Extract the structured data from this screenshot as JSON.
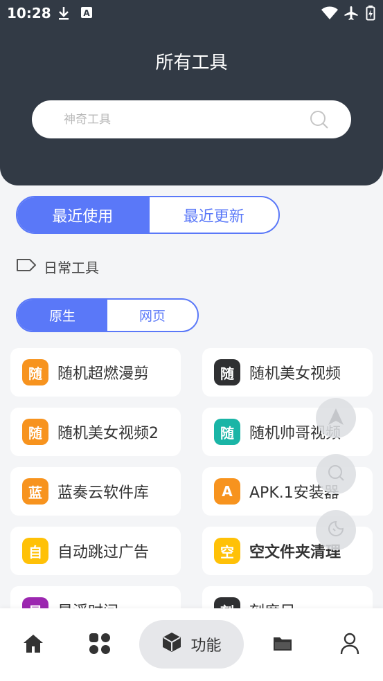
{
  "status_bar": {
    "time": "10:28",
    "icons": [
      "download-icon",
      "a-box-icon",
      "wifi-icon",
      "airplane-icon",
      "battery-icon"
    ]
  },
  "header": {
    "title": "所有工具",
    "search_placeholder": "神奇工具"
  },
  "tabs": {
    "items": [
      {
        "label": "最近使用",
        "active": true
      },
      {
        "label": "最近更新",
        "active": false
      }
    ]
  },
  "section": {
    "label": "日常工具",
    "icon": "tag-icon"
  },
  "subtabs": {
    "items": [
      {
        "label": "原生",
        "active": true
      },
      {
        "label": "网页",
        "active": false
      }
    ]
  },
  "tools": [
    {
      "badge": "随",
      "label": "随机超燃漫剪",
      "color": "#f7931e"
    },
    {
      "badge": "随",
      "label": "随机美女视频",
      "color": "#2f3032"
    },
    {
      "badge": "随",
      "label": "随机美女视频2",
      "color": "#f7931e"
    },
    {
      "badge": "随",
      "label": "随机帅哥视频",
      "color": "#1ab5a6"
    },
    {
      "badge": "蓝",
      "label": "蓝奏云软件库",
      "color": "#f7931e"
    },
    {
      "badge": "A",
      "label": "APK.1安装器",
      "color": "#f7931e"
    },
    {
      "badge": "自",
      "label": "自动跳过广告",
      "color": "#ffc107"
    },
    {
      "badge": "空",
      "label": "空文件夹清理",
      "color": "#ffc107"
    },
    {
      "badge": "星",
      "label": "星浮时间",
      "color": "#9c27b0"
    },
    {
      "badge": "刻",
      "label": "刻度尺",
      "color": "#2f3032"
    }
  ],
  "fabs": [
    "navigate-icon",
    "search-icon",
    "night-mode-icon"
  ],
  "bottom_nav": {
    "items": [
      {
        "icon": "home-icon",
        "label": ""
      },
      {
        "icon": "apps-grid-icon",
        "label": ""
      },
      {
        "icon": "cube-icon",
        "label": "功能",
        "active": true
      },
      {
        "icon": "folder-icon",
        "label": ""
      },
      {
        "icon": "user-icon",
        "label": ""
      }
    ]
  },
  "colors": {
    "header_bg": "#323a45",
    "accent": "#5a78f8",
    "page_bg": "#f4f5f7"
  }
}
